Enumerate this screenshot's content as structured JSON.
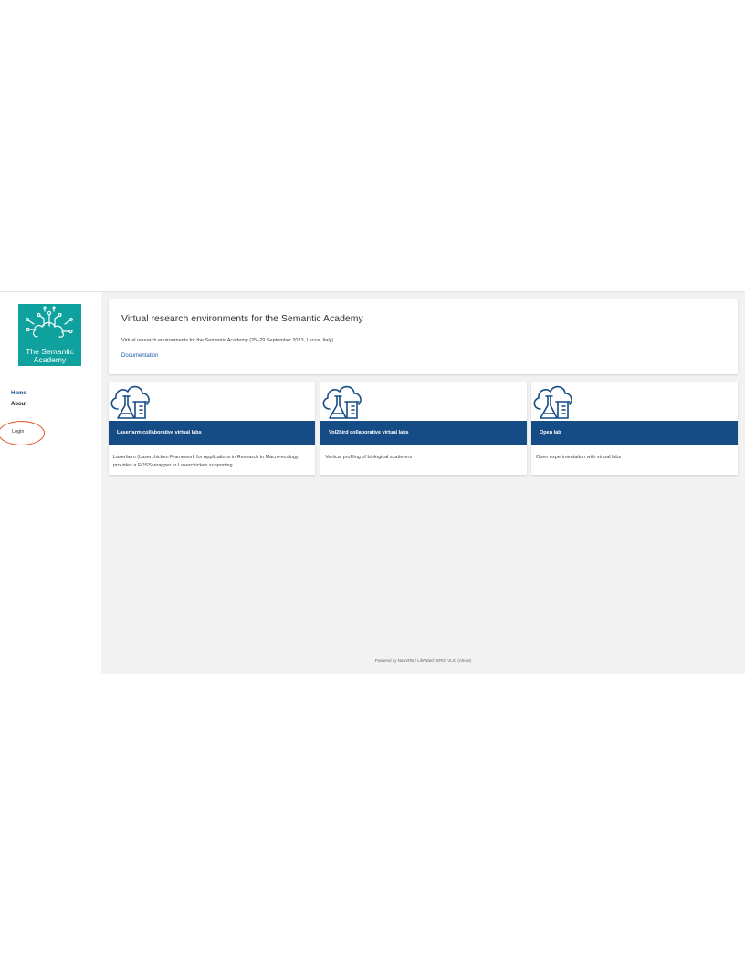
{
  "sidebar": {
    "logo_text_line1": "The Semantic",
    "logo_text_line2": "Academy",
    "logo_color": "#0fa19d",
    "nav": [
      {
        "label": "Home",
        "active": true
      },
      {
        "label": "About",
        "active": false
      }
    ],
    "login_label": "Login"
  },
  "intro": {
    "title": "Virtual research environments for the Semantic Academy",
    "description": "Virtual research environments for the Semantic Academy (25–29 September 2023, Lecce, Italy)",
    "doc_link": "Documentation"
  },
  "cards": [
    {
      "icon": "cloud-lab-icon",
      "title": "Laserfarm collaborative virtual labs",
      "description": "Laserfarm (Laserchicken Framework for Applications in Research in Macro-ecology) provides a FOSS wrapper to Laserchicken supporting..."
    },
    {
      "icon": "cloud-lab-icon",
      "title": "Vol2bird collaborative virtual labs",
      "description": "Vertical profiling of biological scatterers"
    },
    {
      "icon": "cloud-lab-icon",
      "title": "Open lab",
      "description": "Open experimentation with virtual labs"
    }
  ],
  "footer": {
    "text": "Powered by NaaVRE / LifeWatch ERIC VLIC (About)"
  },
  "colors": {
    "accent_blue": "#164c86",
    "link_blue": "#1d5fa8",
    "login_highlight": "#e2572a",
    "main_background": "#f2f2f2"
  }
}
